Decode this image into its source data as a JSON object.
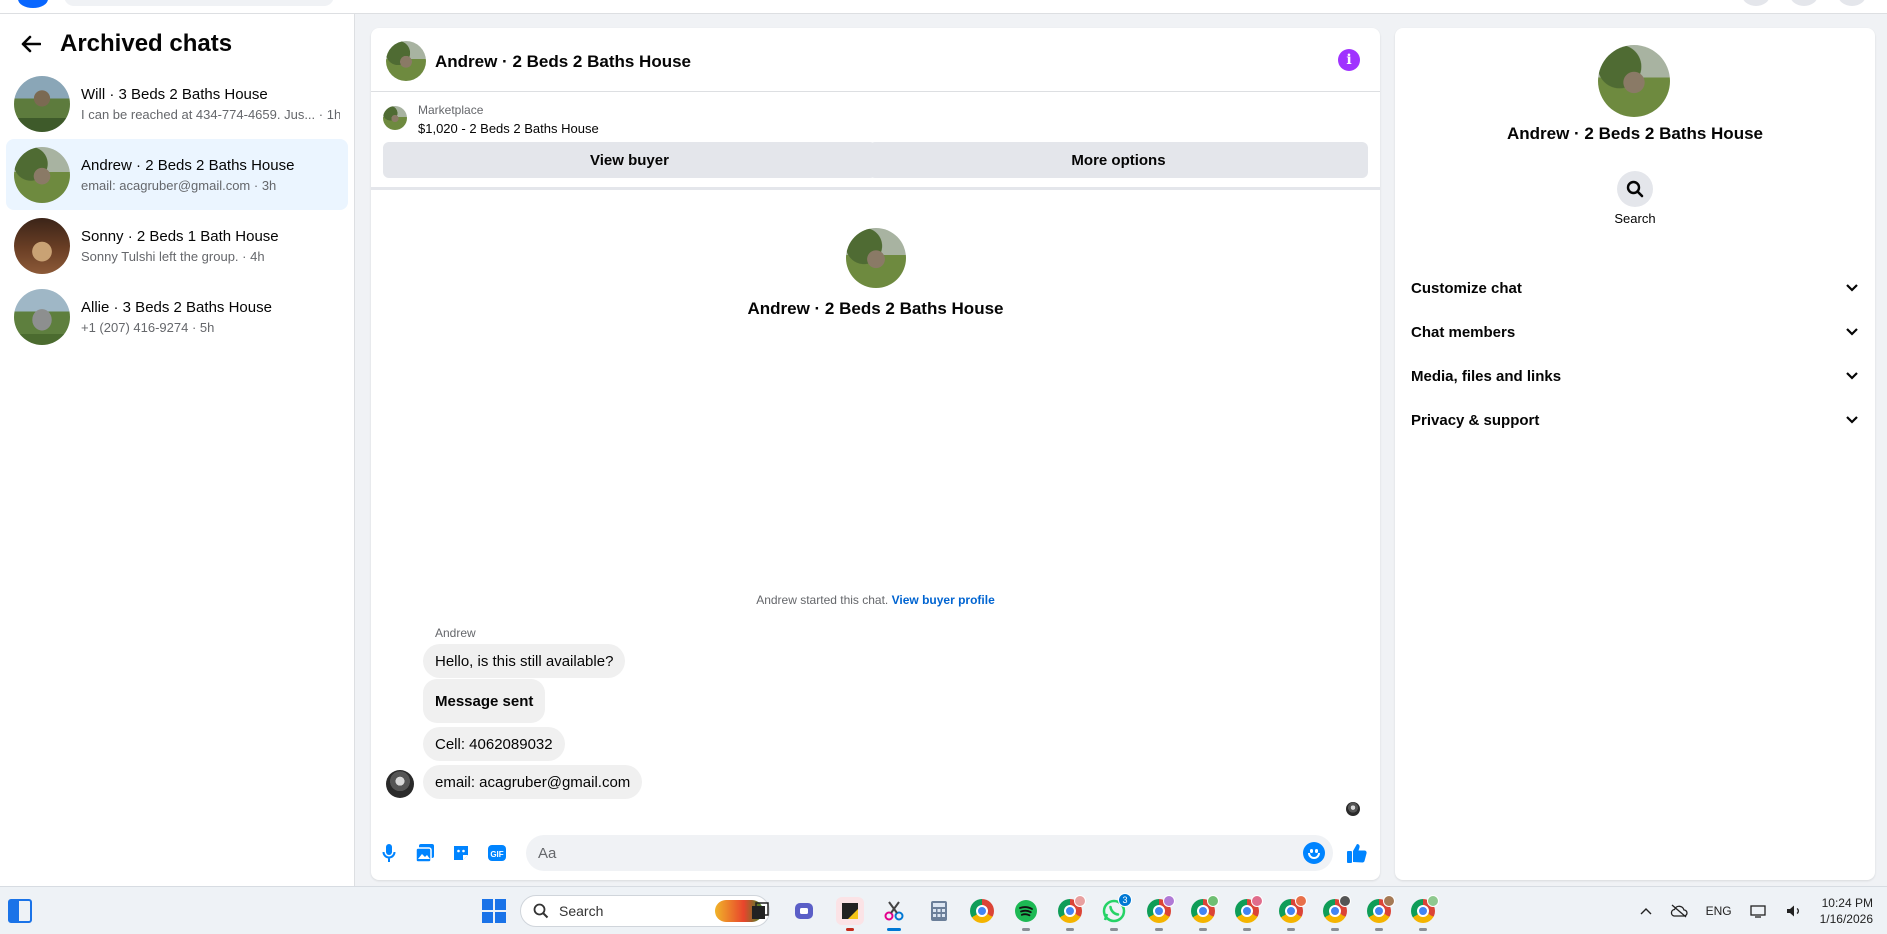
{
  "left_panel": {
    "title": "Archived chats",
    "chats": [
      {
        "name": "Will · 3 Beds 2 Baths House",
        "preview": "I can be reached at 434-774-4659. Jus... · 1h"
      },
      {
        "name": "Andrew · 2 Beds 2 Baths House",
        "preview": "email: acagruber@gmail.com · 3h"
      },
      {
        "name": "Sonny · 2 Beds 1 Bath House",
        "preview": "Sonny Tulshi left the group. · 4h"
      },
      {
        "name": "Allie · 3 Beds 2 Baths House",
        "preview": "+1 (207) 416-9274 · 5h"
      }
    ]
  },
  "conversation": {
    "title": "Andrew · 2 Beds 2 Baths House",
    "marketplace": {
      "label": "Marketplace",
      "listing": "$1,020 - 2 Beds 2 Baths House",
      "view_buyer": "View buyer",
      "more_options": "More options"
    },
    "profile_name": "Andrew · 2 Beds 2 Baths House",
    "started_text": "Andrew started this chat.",
    "view_profile_link": "View buyer profile",
    "sender": "Andrew",
    "messages": [
      "Hello, is this still available?",
      "Message sent",
      "Cell: 4062089032",
      "email: acagruber@gmail.com"
    ],
    "composer_placeholder": "Aa"
  },
  "info_panel": {
    "name": "Andrew · 2 Beds 2 Baths House",
    "search_label": "Search",
    "sections": [
      "Customize chat",
      "Chat members",
      "Media, files and links",
      "Privacy & support"
    ]
  },
  "taskbar": {
    "search_label": "Search",
    "whatsapp_badge": "3",
    "language": "ENG",
    "time": "10:24 PM",
    "date": "1/16/2026"
  },
  "colors": {
    "accent": "#0084ff",
    "info": "#a033ff",
    "link": "#0064d1",
    "active_row": "#ebf5ff"
  }
}
